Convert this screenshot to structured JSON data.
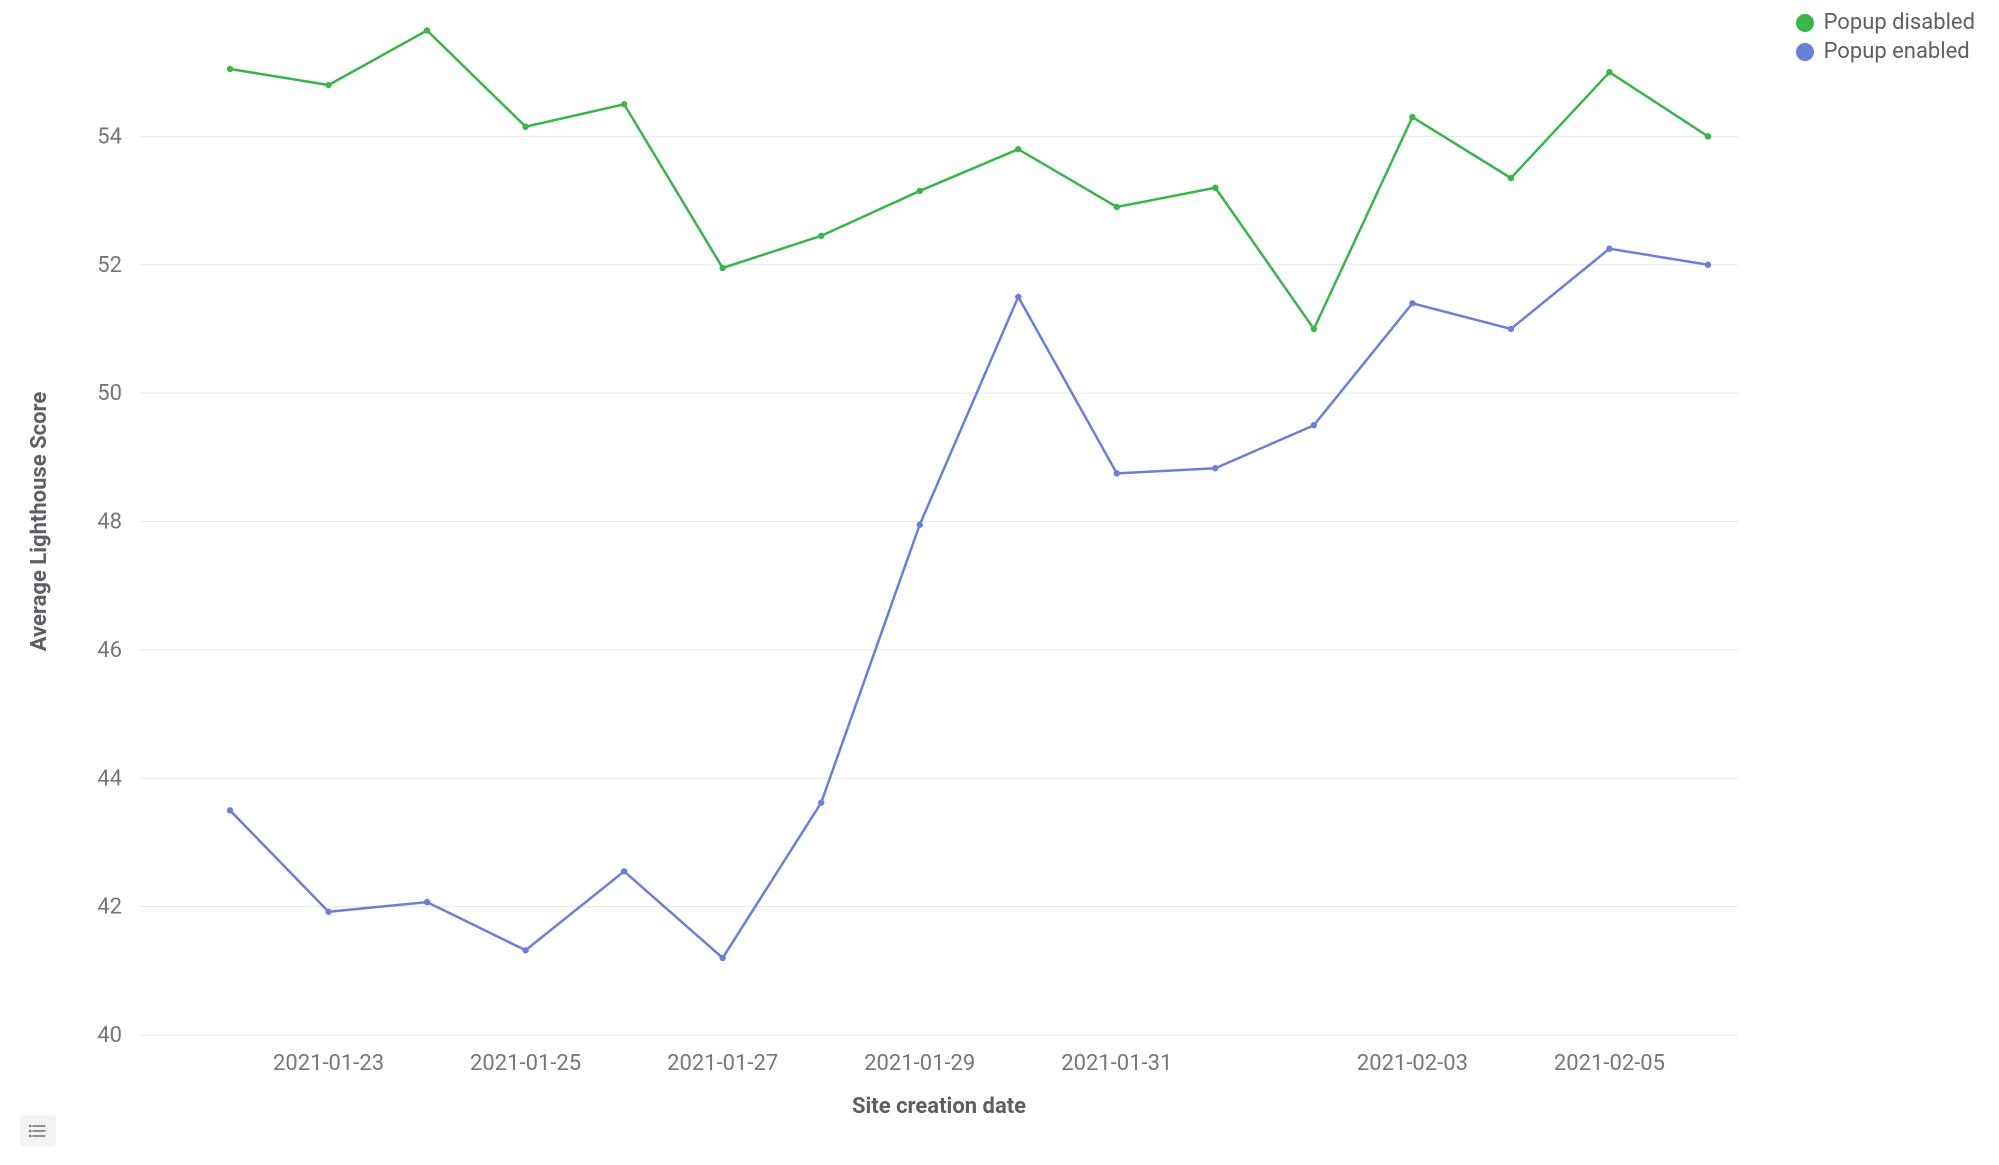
{
  "chart_data": {
    "type": "line",
    "title": "",
    "xlabel": "Site creation date",
    "ylabel": "Average Lighthouse Score",
    "ylim": [
      40,
      56
    ],
    "y_ticks": [
      40,
      42,
      44,
      46,
      48,
      50,
      52,
      54
    ],
    "x_tick_labels": [
      "2021-01-23",
      "2021-01-25",
      "2021-01-27",
      "2021-01-29",
      "2021-01-31",
      "2021-02-03",
      "2021-02-05"
    ],
    "categories": [
      "2021-01-22",
      "2021-01-23",
      "2021-01-24",
      "2021-01-25",
      "2021-01-26",
      "2021-01-27",
      "2021-01-28",
      "2021-01-29",
      "2021-01-30",
      "2021-01-31",
      "2021-02-01",
      "2021-02-02",
      "2021-02-03",
      "2021-02-04",
      "2021-02-05",
      "2021-02-06"
    ],
    "series": [
      {
        "name": "Popup disabled",
        "color": "#39b54a",
        "values": [
          55.05,
          54.8,
          55.65,
          54.15,
          54.5,
          51.95,
          52.45,
          53.15,
          53.8,
          52.9,
          53.2,
          51.0,
          54.3,
          53.35,
          55.0,
          54.0
        ]
      },
      {
        "name": "Popup enabled",
        "color": "#6b7fd7",
        "values": [
          43.5,
          41.92,
          42.07,
          41.32,
          42.55,
          41.2,
          43.62,
          47.95,
          51.5,
          48.75,
          48.83,
          49.5,
          51.4,
          51.0,
          52.25,
          52.0
        ]
      }
    ]
  },
  "legend": {
    "items": [
      {
        "label": "Popup disabled",
        "color": "#39b54a"
      },
      {
        "label": "Popup enabled",
        "color": "#6b7fd7"
      }
    ]
  },
  "buttons": {
    "data_table_tooltip": "Show data table"
  }
}
